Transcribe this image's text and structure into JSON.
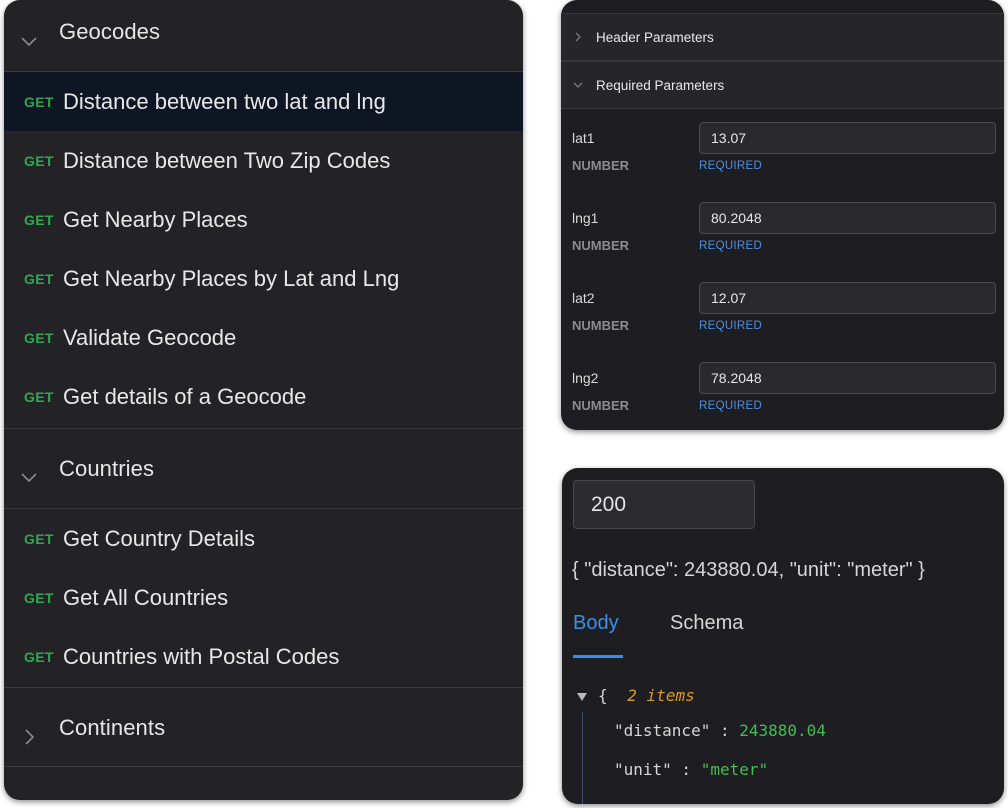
{
  "left_nav": {
    "groups": [
      {
        "title": "Geocodes",
        "endpoints": [
          {
            "method": "GET",
            "label": "Distance between two lat and lng"
          },
          {
            "method": "GET",
            "label": "Distance between Two Zip Codes"
          },
          {
            "method": "GET",
            "label": "Get Nearby Places"
          },
          {
            "method": "GET",
            "label": "Get Nearby Places by Lat and Lng"
          },
          {
            "method": "GET",
            "label": "Validate Geocode"
          },
          {
            "method": "GET",
            "label": "Get details of a Geocode"
          }
        ]
      },
      {
        "title": "Countries",
        "endpoints": [
          {
            "method": "GET",
            "label": "Get Country Details"
          },
          {
            "method": "GET",
            "label": "Get All Countries"
          },
          {
            "method": "GET",
            "label": "Countries with Postal Codes"
          }
        ]
      },
      {
        "title": "Continents",
        "endpoints": []
      }
    ]
  },
  "params": {
    "header_section": "Header Parameters",
    "required_section": "Required Parameters",
    "items": [
      {
        "name": "lat1",
        "type": "NUMBER",
        "value": "13.07",
        "required": "REQUIRED"
      },
      {
        "name": "lng1",
        "type": "NUMBER",
        "value": "80.2048",
        "required": "REQUIRED"
      },
      {
        "name": "lat2",
        "type": "NUMBER",
        "value": "12.07",
        "required": "REQUIRED"
      },
      {
        "name": "lng2",
        "type": "NUMBER",
        "value": "78.2048",
        "required": "REQUIRED"
      }
    ]
  },
  "response": {
    "status": "200",
    "raw": "{ \"distance\": 243880.04, \"unit\": \"meter\" }",
    "tabs": {
      "body": "Body",
      "schema": "Schema"
    },
    "tree": {
      "open_brace": "{",
      "count": "2 items",
      "rows": [
        {
          "key": "\"distance\"",
          "sep": " : ",
          "value": "243880.04"
        },
        {
          "key": "\"unit\"",
          "sep": " : ",
          "value": "\"meter\""
        }
      ]
    }
  },
  "colors": {
    "panel_bg": "#232327",
    "selected_row": "#0e1624",
    "method_get": "#2fa84f",
    "accent_blue": "#3b8ee8",
    "json_value": "#3fbf4f",
    "json_count": "#d89b2b"
  },
  "icons": {
    "expanded": "chevron-down-icon",
    "collapsed": "chevron-right-icon",
    "tree_toggle": "caret-down-icon"
  }
}
